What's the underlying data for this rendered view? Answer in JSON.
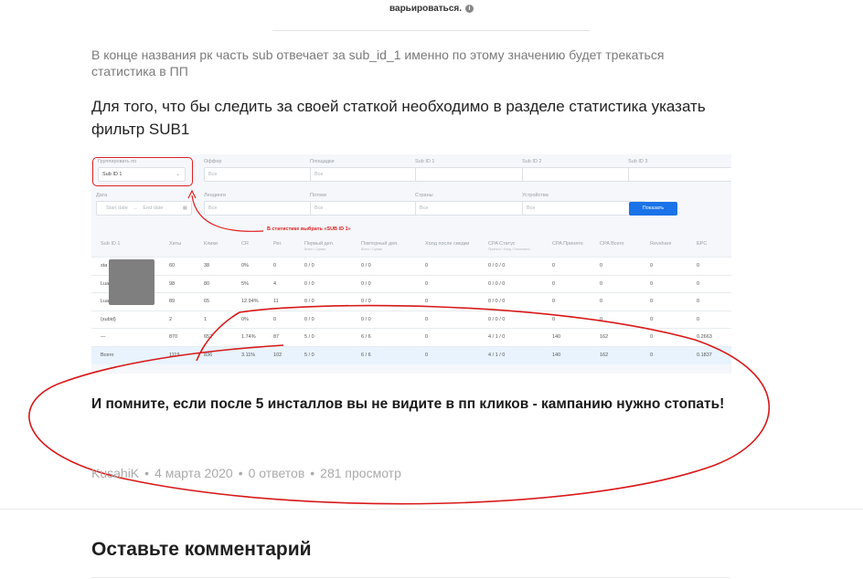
{
  "top_caption": "варьироваться.",
  "note": "В конце названия рк часть sub отвечает за sub_id_1 именно по этому значению будет трекаться статистика в ПП",
  "lead": "Для того, что бы следить за своей статкой необходимо в разделе статистика указать фильтр SUB1",
  "filters": {
    "group_label": "Группировать по",
    "group_value": "Sub ID 1",
    "offer_label": "Оффер",
    "offer_placeholder": "Все",
    "platforms_label": "Площадки",
    "platforms_placeholder": "Все",
    "sub1_label": "Sub ID 1",
    "sub2_label": "Sub ID 2",
    "sub3_label": "Sub ID 3",
    "date_label": "Дата",
    "start_date": "Start date",
    "end_date": "End date",
    "landings_label": "Лендинги",
    "landings_placeholder": "Все",
    "streams_label": "Потоки",
    "streams_placeholder": "Все",
    "countries_label": "Страны",
    "countries_placeholder": "Все",
    "devices_label": "Устройства",
    "devices_placeholder": "Все",
    "show_button": "Показать"
  },
  "annotation": "В статистике выбрать «SUB ID 1»",
  "table": {
    "headers": [
      {
        "label": "Sub ID 1"
      },
      {
        "label": "Хиты"
      },
      {
        "label": "Клики"
      },
      {
        "label": "CR"
      },
      {
        "label": "Рег."
      },
      {
        "label": "Первый деп.",
        "sub": "Всего / Сумма"
      },
      {
        "label": "Повторный деп.",
        "sub": "Всего / Сумма"
      },
      {
        "label": "Холд после сведки"
      },
      {
        "label": "CPA Статус",
        "sub": "Принято / Холд / Отклонено"
      },
      {
        "label": "CPA Принято"
      },
      {
        "label": "CPA Всего"
      },
      {
        "label": "Revshare"
      },
      {
        "label": "EPC"
      }
    ],
    "rows": [
      {
        "name": "sta",
        "values": [
          "60",
          "38",
          "0%",
          "0",
          "0 / 0",
          "0 / 0",
          "0",
          "0 / 0 / 0",
          "0",
          "0",
          "0",
          "0"
        ]
      },
      {
        "name": "Lua",
        "values": [
          "98",
          "80",
          "5%",
          "4",
          "0 / 0",
          "0 / 0",
          "0",
          "0 / 0 / 0",
          "0",
          "0",
          "0",
          "0"
        ]
      },
      {
        "name": "Lua",
        "values": [
          "89",
          "65",
          "12.94%",
          "11",
          "0 / 0",
          "0 / 0",
          "0",
          "0 / 0 / 0",
          "0",
          "0",
          "0",
          "0"
        ]
      },
      {
        "name": "{subid}",
        "values": [
          "2",
          "1",
          "0%",
          "0",
          "0 / 0",
          "0 / 0",
          "0",
          "0 / 0 / 0",
          "0",
          "0",
          "0",
          "0"
        ]
      },
      {
        "name": "—",
        "values": [
          "870",
          "652",
          "1.74%",
          "87",
          "5 / 0",
          "6 / 6",
          "0",
          "4 / 1 / 0",
          "140",
          "162",
          "0",
          "0.2663"
        ]
      },
      {
        "name": "Всего",
        "values": [
          "1119",
          "836",
          "3.11%",
          "102",
          "5 / 0",
          "6 / 6",
          "0",
          "4 / 1 / 0",
          "140",
          "162",
          "0",
          "0.1837"
        ]
      }
    ]
  },
  "remember": "И помните, если после 5 инсталлов вы не видите в пп кликов - кампанию нужно стопать!",
  "meta": {
    "author": "KusahiK",
    "date": "4 марта 2020",
    "answers": "0 ответов",
    "views": "281 просмотр"
  },
  "comment_title": "Оставьте комментарий",
  "colors": {
    "annotation_red": "#e02020",
    "button_blue": "#1a73e8",
    "total_row": "#e8f3fd"
  }
}
